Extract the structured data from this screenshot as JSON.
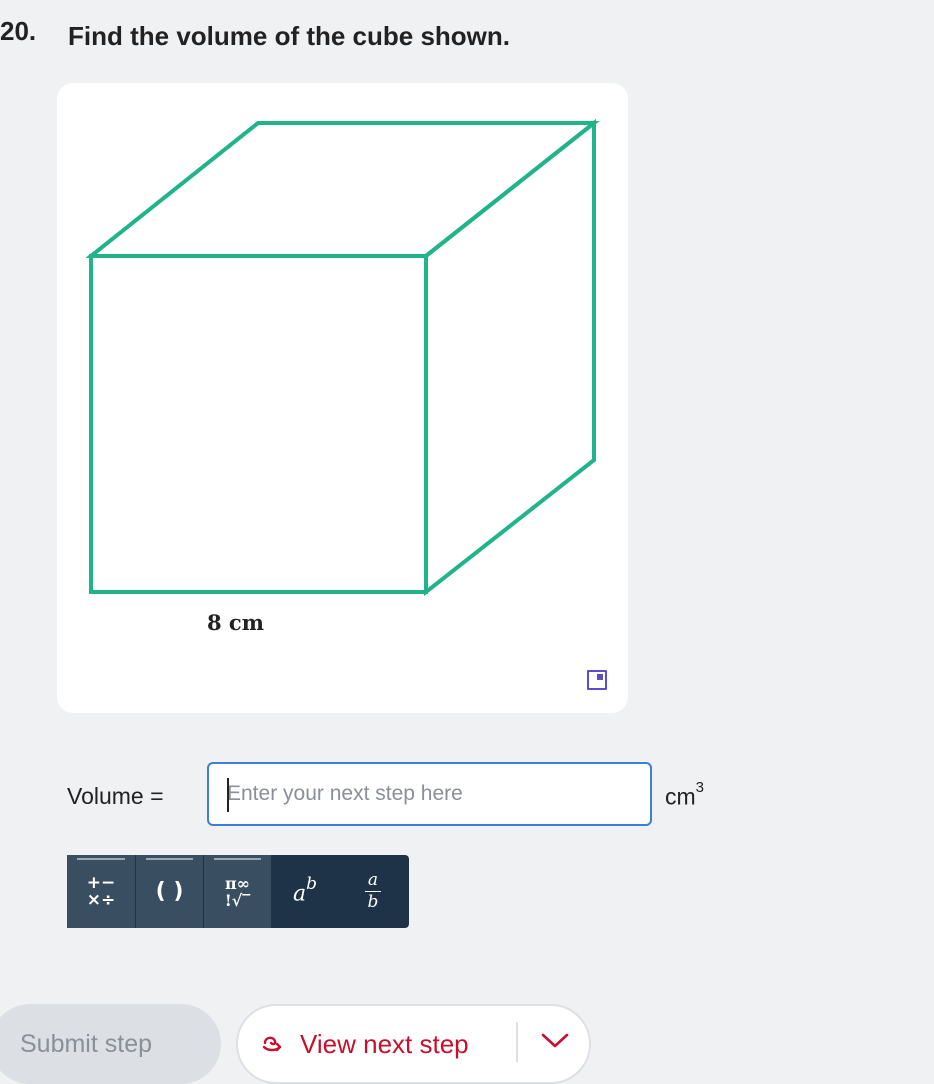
{
  "question": {
    "number": "20.",
    "text": "Find the volume of the cube shown."
  },
  "figure": {
    "dimension_label": "8 cm",
    "stroke_color": "#21b38a",
    "expand_icon": "expand-icon"
  },
  "answer": {
    "label": "Volume =",
    "placeholder": "Enter your next step here",
    "value": "",
    "unit": "cm",
    "unit_exponent": "3"
  },
  "math_toolbar": {
    "operators": {
      "top": "+−",
      "bottom": "×÷"
    },
    "parentheses": "( )",
    "constants": {
      "top": "π∞",
      "bottom": "!√‾"
    },
    "power": {
      "base": "a",
      "exponent": "b"
    },
    "fraction": {
      "numerator": "a",
      "denominator": "b"
    }
  },
  "actions": {
    "submit_label": "Submit step",
    "next_label": "View next step",
    "next_icon": "reveal-arrow-icon",
    "menu_icon": "chevron-down-icon"
  },
  "colors": {
    "background": "#f0f1f3",
    "accent": "#c8102e",
    "toolbar": "#1e3347",
    "input_border": "#3b7fd6"
  }
}
